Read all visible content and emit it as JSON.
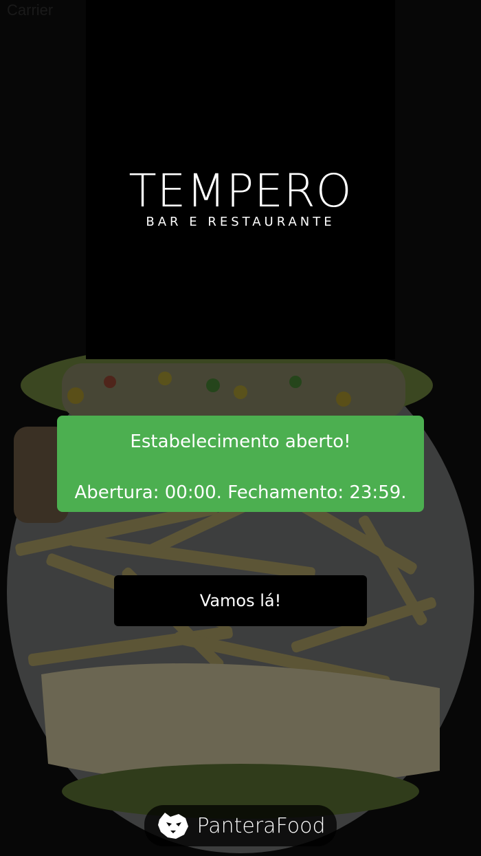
{
  "status_bar": {
    "left_text": "Carrier"
  },
  "logo": {
    "title": "TEMPERO",
    "subtitle": "BAR E RESTAURANTE"
  },
  "status_card": {
    "open_message": "Estabelecimento aberto!",
    "hours_message": "Abertura: 00:00. Fechamento: 23:59.",
    "color": "#4caf50"
  },
  "cta": {
    "label": "Vamos lá!"
  },
  "footer": {
    "brand": "PanteraFood",
    "icon": "panther-icon"
  }
}
